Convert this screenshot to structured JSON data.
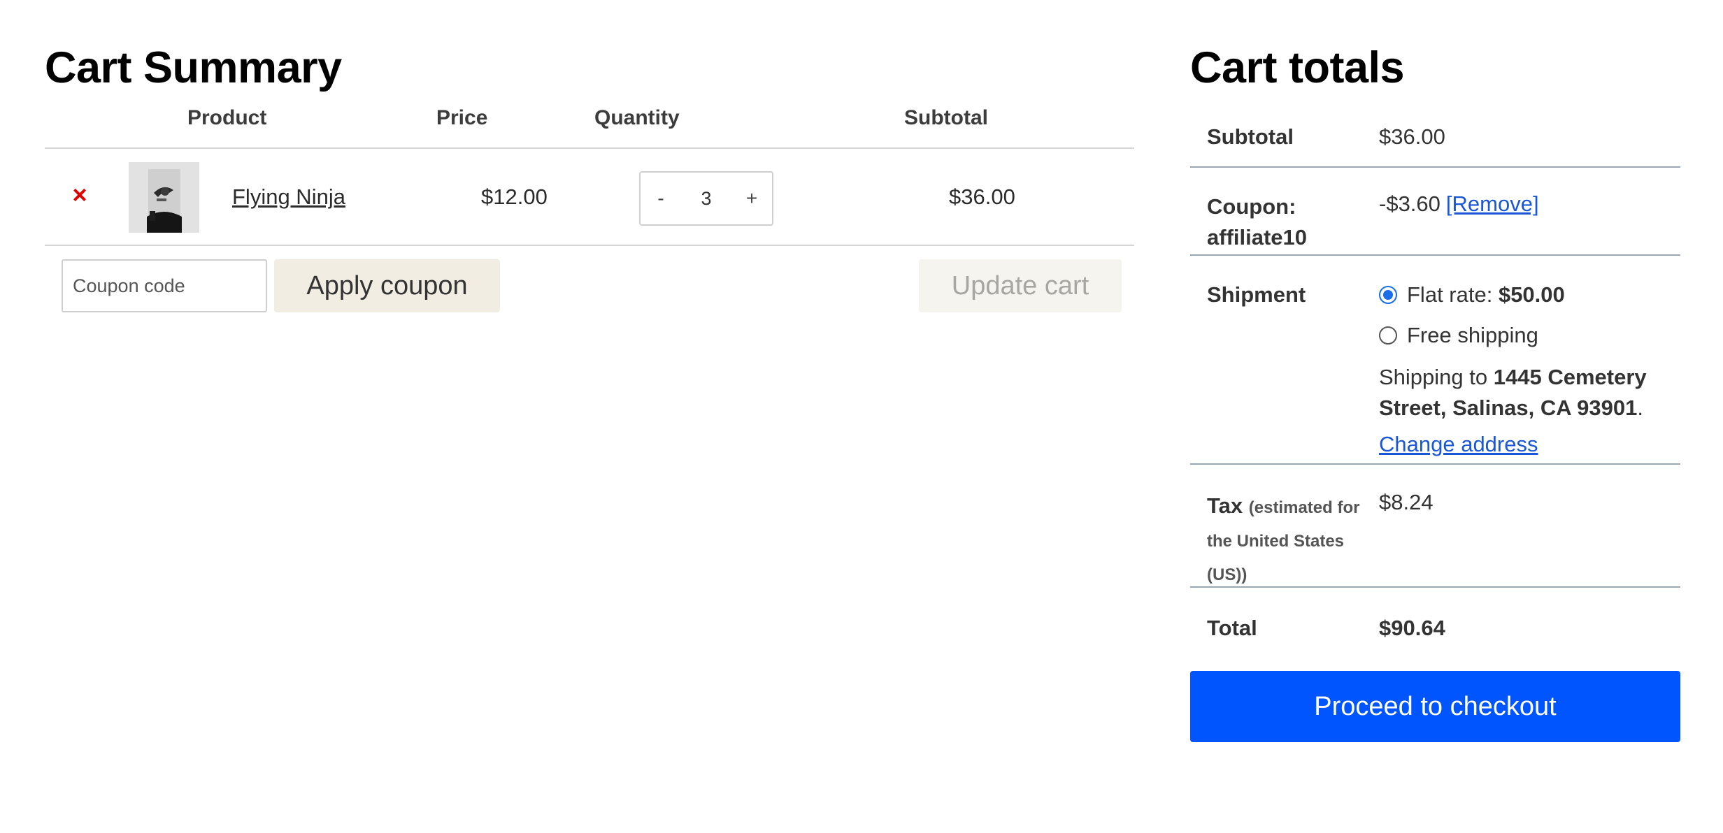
{
  "cart_summary": {
    "title": "Cart Summary",
    "headers": {
      "product": "Product",
      "price": "Price",
      "quantity": "Quantity",
      "subtotal": "Subtotal"
    },
    "items": [
      {
        "remove_icon": "×",
        "product_name": "Flying Ninja",
        "price": "$12.00",
        "quantity": "3",
        "subtotal": "$36.00"
      }
    ],
    "qty_minus": "-",
    "qty_plus": "+",
    "coupon_placeholder": "Coupon code",
    "apply_coupon_label": "Apply coupon",
    "update_cart_label": "Update cart"
  },
  "cart_totals": {
    "title": "Cart totals",
    "subtotal_label": "Subtotal",
    "subtotal_value": "$36.00",
    "coupon_label": "Coupon: affiliate10",
    "coupon_value": "-$3.60",
    "coupon_remove": "[Remove]",
    "shipment_label": "Shipment",
    "shipping_options": [
      {
        "label": "Flat rate:",
        "price": "$50.00",
        "selected": true
      },
      {
        "label": "Free shipping",
        "selected": false
      }
    ],
    "shipping_to_prefix": "Shipping to",
    "shipping_address": "1445 Cemetery Street, Salinas, CA 93901",
    "shipping_to_suffix": ".",
    "change_address": "Change address",
    "tax_label": "Tax",
    "tax_note": "(estimated for the United States (US))",
    "tax_value": "$8.24",
    "total_label": "Total",
    "total_value": "$90.64",
    "checkout_label": "Proceed to checkout"
  },
  "colors": {
    "accent": "#0055ff",
    "link": "#1a57d6",
    "remove": "#e00000",
    "radio": "#1a6ee8"
  },
  "icons": {
    "remove": "close-icon",
    "thumbnail": "ninja-poster-image"
  }
}
